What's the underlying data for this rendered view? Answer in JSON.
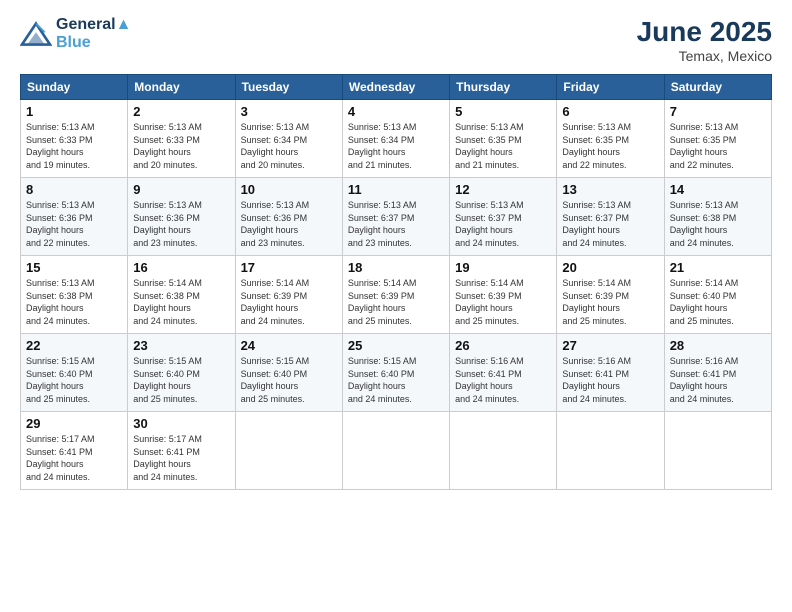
{
  "header": {
    "logo_line1": "General",
    "logo_line2": "Blue",
    "month": "June 2025",
    "location": "Temax, Mexico"
  },
  "weekdays": [
    "Sunday",
    "Monday",
    "Tuesday",
    "Wednesday",
    "Thursday",
    "Friday",
    "Saturday"
  ],
  "weeks": [
    [
      {
        "day": "1",
        "sunrise": "5:13 AM",
        "sunset": "6:33 PM",
        "daylight": "13 hours and 19 minutes."
      },
      {
        "day": "2",
        "sunrise": "5:13 AM",
        "sunset": "6:33 PM",
        "daylight": "13 hours and 20 minutes."
      },
      {
        "day": "3",
        "sunrise": "5:13 AM",
        "sunset": "6:34 PM",
        "daylight": "13 hours and 20 minutes."
      },
      {
        "day": "4",
        "sunrise": "5:13 AM",
        "sunset": "6:34 PM",
        "daylight": "13 hours and 21 minutes."
      },
      {
        "day": "5",
        "sunrise": "5:13 AM",
        "sunset": "6:35 PM",
        "daylight": "13 hours and 21 minutes."
      },
      {
        "day": "6",
        "sunrise": "5:13 AM",
        "sunset": "6:35 PM",
        "daylight": "13 hours and 22 minutes."
      },
      {
        "day": "7",
        "sunrise": "5:13 AM",
        "sunset": "6:35 PM",
        "daylight": "13 hours and 22 minutes."
      }
    ],
    [
      {
        "day": "8",
        "sunrise": "5:13 AM",
        "sunset": "6:36 PM",
        "daylight": "13 hours and 22 minutes."
      },
      {
        "day": "9",
        "sunrise": "5:13 AM",
        "sunset": "6:36 PM",
        "daylight": "13 hours and 23 minutes."
      },
      {
        "day": "10",
        "sunrise": "5:13 AM",
        "sunset": "6:36 PM",
        "daylight": "13 hours and 23 minutes."
      },
      {
        "day": "11",
        "sunrise": "5:13 AM",
        "sunset": "6:37 PM",
        "daylight": "13 hours and 23 minutes."
      },
      {
        "day": "12",
        "sunrise": "5:13 AM",
        "sunset": "6:37 PM",
        "daylight": "13 hours and 24 minutes."
      },
      {
        "day": "13",
        "sunrise": "5:13 AM",
        "sunset": "6:37 PM",
        "daylight": "13 hours and 24 minutes."
      },
      {
        "day": "14",
        "sunrise": "5:13 AM",
        "sunset": "6:38 PM",
        "daylight": "13 hours and 24 minutes."
      }
    ],
    [
      {
        "day": "15",
        "sunrise": "5:13 AM",
        "sunset": "6:38 PM",
        "daylight": "13 hours and 24 minutes."
      },
      {
        "day": "16",
        "sunrise": "5:14 AM",
        "sunset": "6:38 PM",
        "daylight": "13 hours and 24 minutes."
      },
      {
        "day": "17",
        "sunrise": "5:14 AM",
        "sunset": "6:39 PM",
        "daylight": "13 hours and 24 minutes."
      },
      {
        "day": "18",
        "sunrise": "5:14 AM",
        "sunset": "6:39 PM",
        "daylight": "13 hours and 25 minutes."
      },
      {
        "day": "19",
        "sunrise": "5:14 AM",
        "sunset": "6:39 PM",
        "daylight": "13 hours and 25 minutes."
      },
      {
        "day": "20",
        "sunrise": "5:14 AM",
        "sunset": "6:39 PM",
        "daylight": "13 hours and 25 minutes."
      },
      {
        "day": "21",
        "sunrise": "5:14 AM",
        "sunset": "6:40 PM",
        "daylight": "13 hours and 25 minutes."
      }
    ],
    [
      {
        "day": "22",
        "sunrise": "5:15 AM",
        "sunset": "6:40 PM",
        "daylight": "13 hours and 25 minutes."
      },
      {
        "day": "23",
        "sunrise": "5:15 AM",
        "sunset": "6:40 PM",
        "daylight": "13 hours and 25 minutes."
      },
      {
        "day": "24",
        "sunrise": "5:15 AM",
        "sunset": "6:40 PM",
        "daylight": "13 hours and 25 minutes."
      },
      {
        "day": "25",
        "sunrise": "5:15 AM",
        "sunset": "6:40 PM",
        "daylight": "13 hours and 24 minutes."
      },
      {
        "day": "26",
        "sunrise": "5:16 AM",
        "sunset": "6:41 PM",
        "daylight": "13 hours and 24 minutes."
      },
      {
        "day": "27",
        "sunrise": "5:16 AM",
        "sunset": "6:41 PM",
        "daylight": "13 hours and 24 minutes."
      },
      {
        "day": "28",
        "sunrise": "5:16 AM",
        "sunset": "6:41 PM",
        "daylight": "13 hours and 24 minutes."
      }
    ],
    [
      {
        "day": "29",
        "sunrise": "5:17 AM",
        "sunset": "6:41 PM",
        "daylight": "13 hours and 24 minutes."
      },
      {
        "day": "30",
        "sunrise": "5:17 AM",
        "sunset": "6:41 PM",
        "daylight": "13 hours and 24 minutes."
      },
      null,
      null,
      null,
      null,
      null
    ]
  ]
}
